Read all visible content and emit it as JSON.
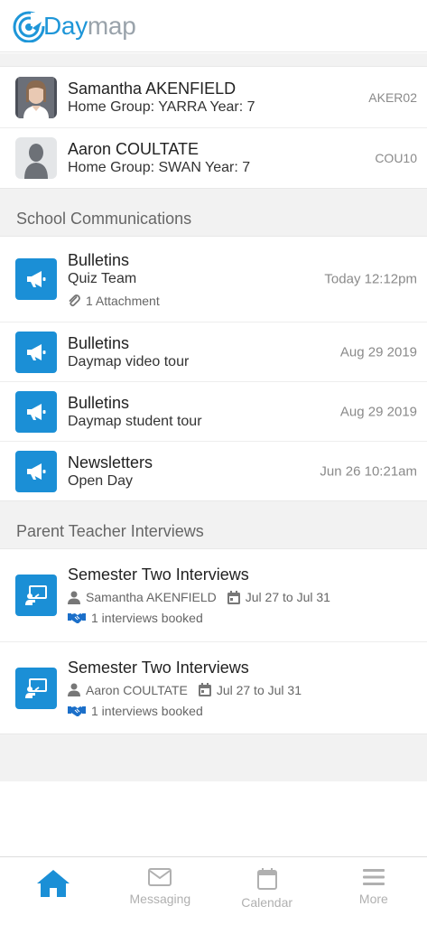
{
  "app": {
    "logo_day": "Day",
    "logo_map": "map"
  },
  "students": [
    {
      "name": "Samantha AKENFIELD",
      "details": "Home Group: YARRA Year: 7",
      "code": "AKER02"
    },
    {
      "name": "Aaron COULTATE",
      "details": "Home Group: SWAN Year: 7",
      "code": "COU10"
    }
  ],
  "communications": {
    "header": "School Communications",
    "items": [
      {
        "category": "Bulletins",
        "title": "Quiz Team",
        "time": "Today 12:12pm",
        "attachment": "1 Attachment"
      },
      {
        "category": "Bulletins",
        "title": "Daymap video tour",
        "time": "Aug 29 2019"
      },
      {
        "category": "Bulletins",
        "title": "Daymap student tour",
        "time": "Aug 29 2019"
      },
      {
        "category": "Newsletters",
        "title": "Open Day",
        "time": "Jun 26 10:21am"
      }
    ]
  },
  "interviews": {
    "header": "Parent Teacher Interviews",
    "items": [
      {
        "title": "Semester Two Interviews",
        "student": "Samantha AKENFIELD",
        "dates": "Jul 27 to Jul 31",
        "booked": "1 interviews booked"
      },
      {
        "title": "Semester Two Interviews",
        "student": "Aaron COULTATE",
        "dates": "Jul 27 to Jul 31",
        "booked": "1 interviews booked"
      }
    ]
  },
  "tabs": [
    {
      "label": "",
      "icon": "home-icon",
      "active": true
    },
    {
      "label": "Messaging",
      "icon": "mail-icon"
    },
    {
      "label": "Calendar",
      "icon": "calendar-icon"
    },
    {
      "label": "More",
      "icon": "menu-icon"
    }
  ],
  "colors": {
    "accent": "#1b8fd6",
    "logo_gray": "#9aa3ab",
    "tab_inactive": "#b0b0b0",
    "background": "#f2f2f2"
  }
}
